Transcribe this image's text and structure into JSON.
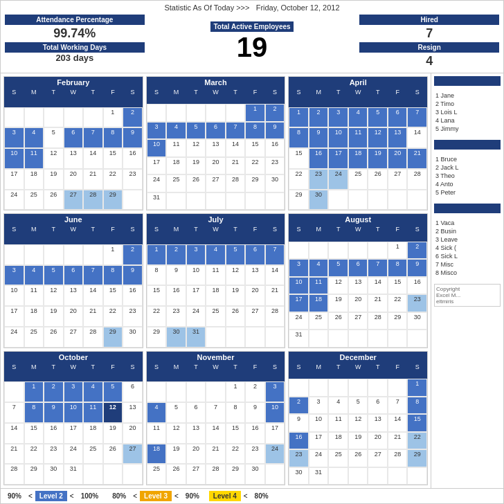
{
  "header": {
    "statistic_label": "Statistic As Of Today   >>>",
    "date": "Friday, October 12, 2012",
    "attendance_label": "Attendance Percentage",
    "attendance_value": "99.74%",
    "working_days_label": "Total Working Days",
    "working_days_value": "203 days",
    "total_active_label": "Total Active Employees",
    "total_active_value": "19",
    "hired_label": "Hired",
    "hired_value": "7",
    "resign_label": "Resign",
    "resign_value": "4"
  },
  "sidebar_top": {
    "header": "",
    "items": [
      {
        "num": "1",
        "name": "Jane"
      },
      {
        "num": "2",
        "name": "Timo"
      },
      {
        "num": "3",
        "name": "Lois L"
      },
      {
        "num": "4",
        "name": "Lana"
      },
      {
        "num": "5",
        "name": "Jimmy"
      }
    ]
  },
  "sidebar_mid": {
    "items": [
      {
        "num": "1",
        "name": "Bruce"
      },
      {
        "num": "2",
        "name": "Jack L"
      },
      {
        "num": "3",
        "name": "Theo"
      },
      {
        "num": "4",
        "name": "Anto"
      },
      {
        "num": "5",
        "name": "Peter"
      }
    ]
  },
  "sidebar_bottom": {
    "items": [
      {
        "num": "1",
        "name": "Vaca"
      },
      {
        "num": "2",
        "name": "Busin"
      },
      {
        "num": "3",
        "name": "Leave"
      },
      {
        "num": "4",
        "name": "Sick ("
      },
      {
        "num": "6",
        "name": "Sick L"
      },
      {
        "num": "7",
        "name": "Misc"
      },
      {
        "num": "8",
        "name": "Misco"
      }
    ]
  },
  "footer": {
    "l2_min": "90%",
    "l2_lt": "<",
    "l2_label": "Level 2",
    "l2_lt2": "<",
    "l2_max": "100%",
    "l3_min": "80%",
    "l3_lt": "<",
    "l3_label": "Level 3",
    "l3_lt2": "<",
    "l3_max": "90%",
    "l4_label": "Level 4",
    "l4_lt": "<",
    "l4_max": "80%"
  },
  "calendars": {
    "february": {
      "name": "February",
      "days": [
        "",
        "",
        "",
        "1",
        "2",
        "3",
        "4",
        "5",
        "6",
        "7",
        "8",
        "9",
        "10",
        "11",
        "12",
        "13",
        "14",
        "15",
        "16",
        "17",
        "18",
        "19",
        "20",
        "21",
        "22",
        "23",
        "24",
        "25",
        "26",
        "27",
        "28",
        "29",
        "",
        "",
        "",
        ""
      ]
    },
    "march": {
      "name": "March"
    },
    "april": {
      "name": "April"
    },
    "june": {
      "name": "June"
    },
    "july": {
      "name": "July"
    },
    "august": {
      "name": "August"
    },
    "october": {
      "name": "October"
    },
    "november": {
      "name": "November"
    },
    "december": {
      "name": "December"
    }
  }
}
